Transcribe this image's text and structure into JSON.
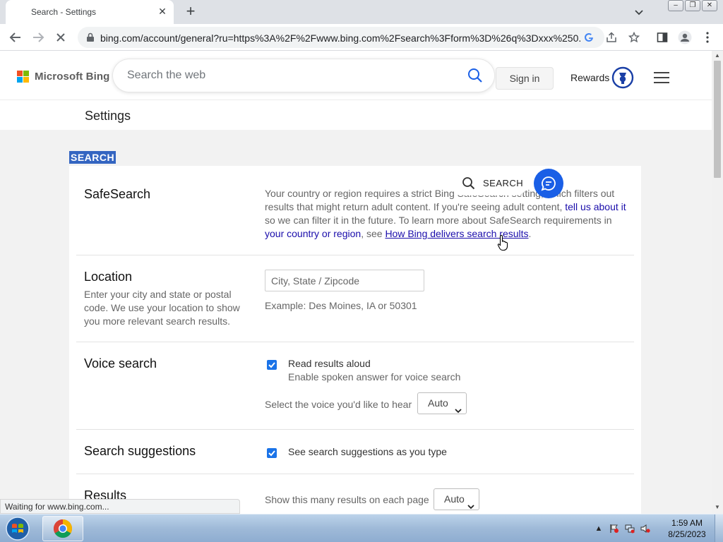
{
  "browser": {
    "tab_title": "Search - Settings",
    "tab_close": "✕",
    "new_tab": "+",
    "url": "bing.com/account/general?ru=https%3A%2F%2Fwww.bing.com%2Fsearch%3Fform%3D%26q%3Dxxx%250...",
    "status": "Waiting for www.bing.com..."
  },
  "bing": {
    "logo_text": "Microsoft Bing",
    "search_placeholder": "Search the web",
    "sign_in": "Sign in",
    "rewards": "Rewards",
    "brand_colors": [
      "#f25022",
      "#7fba00",
      "#00a4ef",
      "#ffb900"
    ]
  },
  "settings": {
    "page_title": "Settings",
    "section": "SEARCH",
    "floating_search": "SEARCH",
    "safesearch": {
      "title": "SafeSearch",
      "text_a": "Your country or region requires a strict Bing SafeSearch setting, which filters out results that might return adult content. If you're seeing adult content, ",
      "link_tell": "tell us about it",
      "text_b": " so we can filter it in the future. To learn more about SafeSearch requirements in ",
      "link_region": "your country or region",
      "text_c": ", see ",
      "link_how": "How Bing delivers search results",
      "text_d": "."
    },
    "location": {
      "title": "Location",
      "description": "Enter your city and state or postal code. We use your location to show you more relevant search results.",
      "placeholder": "City, State / Zipcode",
      "example": "Example: Des Moines, IA or 50301"
    },
    "voice": {
      "title": "Voice search",
      "checkbox_label": "Read results aloud",
      "checkbox_sub": "Enable spoken answer for voice search",
      "checked": true,
      "voice_prompt": "Select the voice you'd like to hear",
      "voice_value": "Auto"
    },
    "suggestions": {
      "title": "Search suggestions",
      "checkbox_label": "See search suggestions as you type",
      "checked": true
    },
    "results": {
      "title": "Results",
      "prompt": "Show this many results on each page",
      "value": "Auto"
    }
  },
  "taskbar": {
    "time": "1:59 AM",
    "date": "8/25/2023"
  }
}
